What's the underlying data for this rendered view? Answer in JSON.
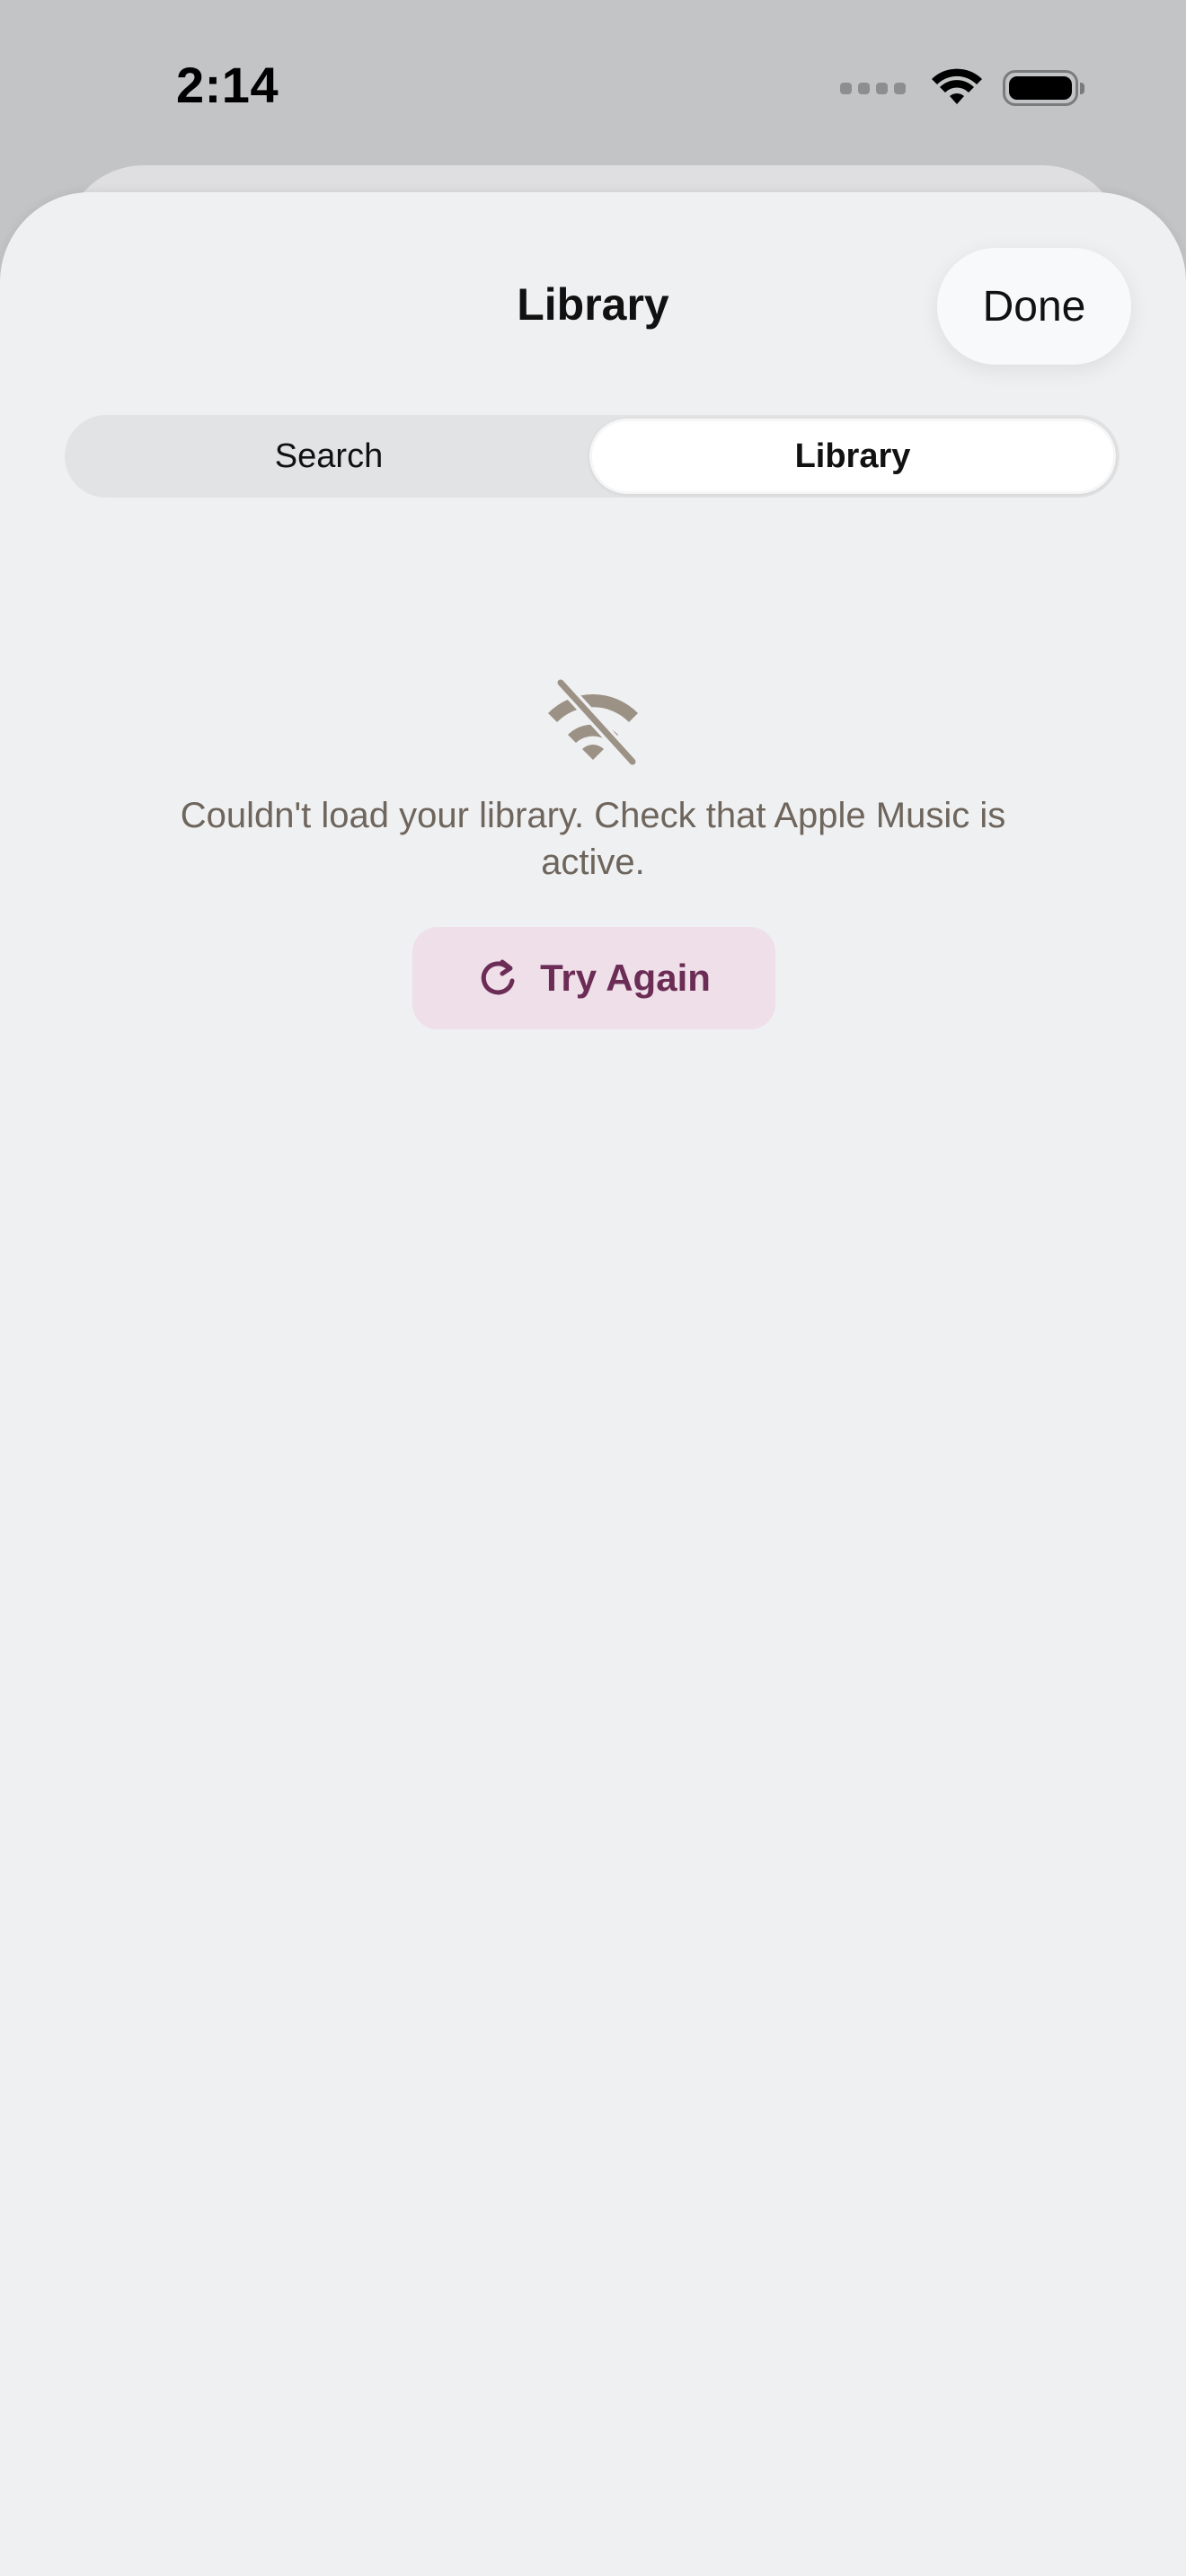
{
  "status_bar": {
    "time": "2:14",
    "icons": [
      "cellular-signal-icon",
      "wifi-icon",
      "battery-icon"
    ]
  },
  "sheet": {
    "title": "Library",
    "done_label": "Done"
  },
  "segmented_control": {
    "segments": [
      {
        "label": "Search",
        "selected": false
      },
      {
        "label": "Library",
        "selected": true
      }
    ]
  },
  "empty_state": {
    "icon": "wifi-slash-icon",
    "message": "Couldn't load your library. Check that Apple Music is active.",
    "retry_label": "Try Again",
    "retry_icon": "refresh-icon"
  },
  "colors": {
    "sheet_background": "#eff0f2",
    "message_text": "#6e655c",
    "icon_tint": "#9b9185",
    "retry_background": "#efdfe8",
    "retry_text": "#6b2c55"
  }
}
